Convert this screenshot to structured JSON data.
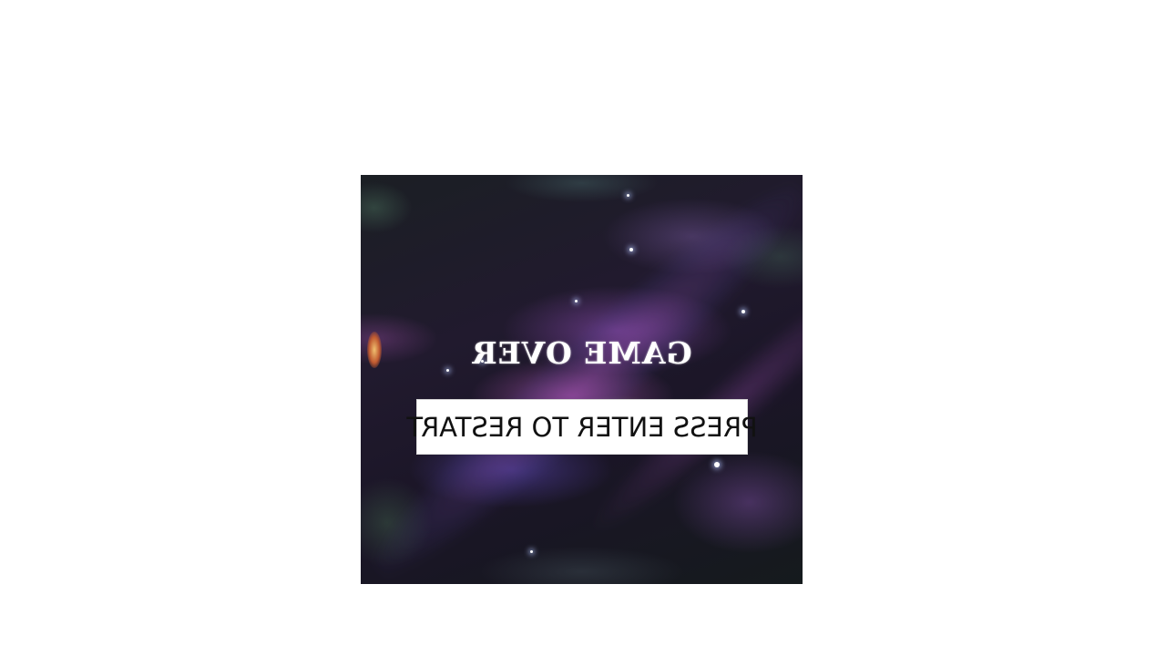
{
  "game": {
    "title": "GAME OVER",
    "restart_prompt": "PRESS ENTER TO RESTART"
  }
}
